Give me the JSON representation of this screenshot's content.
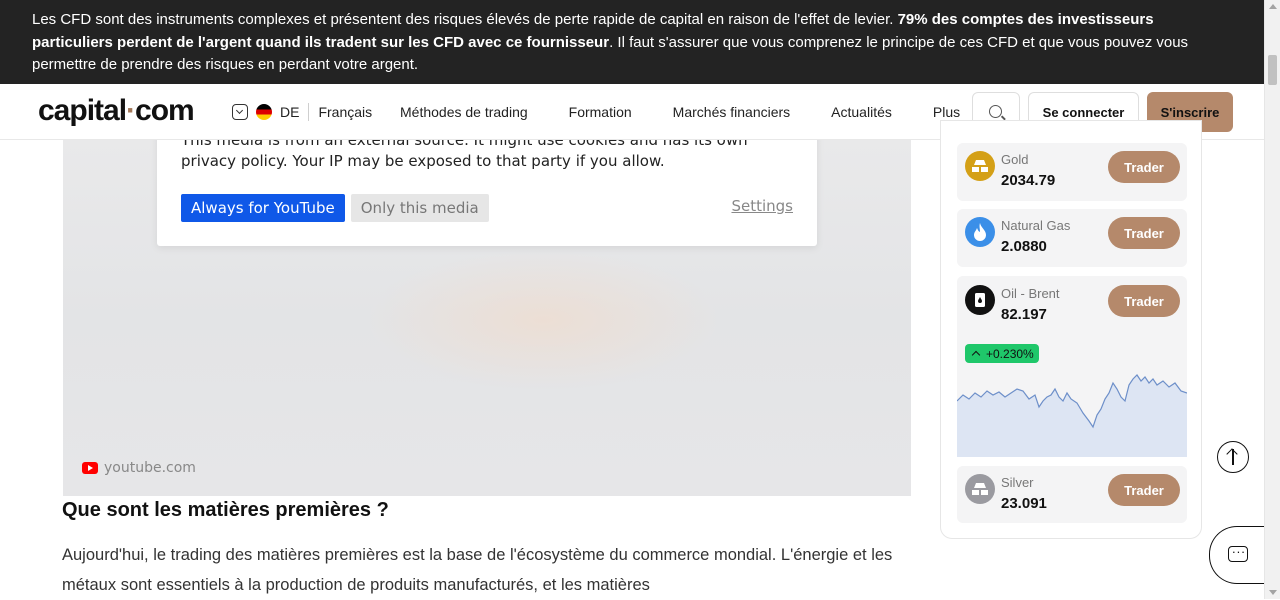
{
  "risk_banner": {
    "text_1": "Les CFD sont des instruments complexes et présentent des risques élevés de perte rapide de capital en raison de l'effet de levier. ",
    "text_bold": "79% des comptes des investisseurs particuliers perdent de l'argent quand ils tradent sur les CFD avec ce fournisseur",
    "text_2": ". Il faut s'assurer que vous comprenez le principe de ces CFD et que vous pouvez vous permettre de prendre des risques en perdant votre argent."
  },
  "header": {
    "logo_part1": "capital",
    "logo_dot": "·",
    "logo_part2": "com",
    "country": "DE",
    "language": "Français",
    "nav": [
      "Méthodes de trading",
      "Formation",
      "Marchés financiers",
      "Actualités",
      "Plus"
    ],
    "login_label": "Se connecter",
    "signup_label": "S'inscrire"
  },
  "video": {
    "consent_text_1": "This media is from an external source. It might use cookies and has its own",
    "consent_text_2": "privacy policy. Your IP may be exposed to that party if you allow.",
    "always_label": "Always for YouTube",
    "only_label": "Only this media",
    "settings_label": "Settings",
    "source": "youtube.com"
  },
  "article": {
    "title": "Que sont les matières premières ?",
    "body": "Aujourd'hui, le trading des matières premières est la base de l'écosystème du commerce mondial. L'énergie et les métaux sont essentiels à la production de produits manufacturés, et les matières"
  },
  "markets": [
    {
      "name": "Gold",
      "price": "2034.79",
      "button": "Trader",
      "icon": "gold-bars-icon",
      "color": "#d4a017"
    },
    {
      "name": "Natural Gas",
      "price": "2.0880",
      "button": "Trader",
      "icon": "flame-icon",
      "color": "#3b8fe8"
    },
    {
      "name": "Oil - Brent",
      "price": "82.197",
      "button": "Trader",
      "icon": "oil-barrel-icon",
      "color": "#111111",
      "change": "+0.230%"
    },
    {
      "name": "Silver",
      "price": "23.091",
      "button": "Trader",
      "icon": "silver-bars-icon",
      "color": "#9a9aa0"
    }
  ],
  "colors": {
    "accent": "#b5896b",
    "banner_bg": "#232323",
    "positive": "#1fc76a",
    "youtube_button": "#0f58e8"
  }
}
